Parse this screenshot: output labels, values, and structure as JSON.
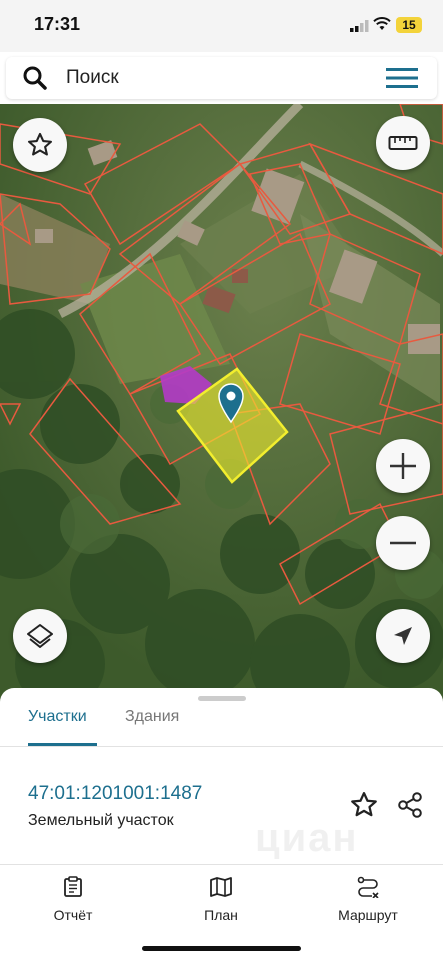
{
  "status_bar": {
    "time": "17:31",
    "battery": "15"
  },
  "search": {
    "placeholder": "Поиск"
  },
  "map": {
    "icons": {
      "favorite": "star-outline-icon",
      "ruler": "ruler-icon",
      "layers": "layers-icon",
      "zoom_in": "plus-icon",
      "zoom_out": "minus-icon",
      "locate": "navigation-arrow-icon"
    },
    "colors": {
      "parcel_border": "#e85a3f",
      "selected_parcel": "#f2ee2e",
      "building_highlight": "#b43bc8",
      "pin": "#1d6f8e"
    }
  },
  "sheet": {
    "tabs": [
      {
        "label": "Участки",
        "active": true
      },
      {
        "label": "Здания",
        "active": false
      }
    ],
    "parcel": {
      "cadastral_number": "47:01:1201001:1487",
      "type": "Земельный участок"
    },
    "watermark": "циан"
  },
  "bottom_nav": [
    {
      "label": "Отчёт",
      "icon": "report-icon"
    },
    {
      "label": "План",
      "icon": "map-plan-icon"
    },
    {
      "label": "Маршрут",
      "icon": "route-icon"
    }
  ],
  "accent_color": "#1d6f8e"
}
